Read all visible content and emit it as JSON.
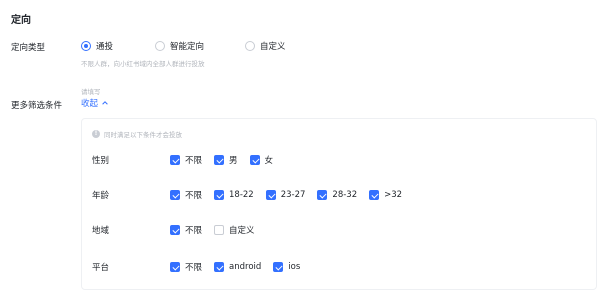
{
  "section": {
    "title": "定向"
  },
  "targeting_type": {
    "label": "定向类型",
    "options": [
      {
        "label": "通投",
        "checked": true
      },
      {
        "label": "智能定向",
        "checked": false
      },
      {
        "label": "自定义",
        "checked": false
      }
    ],
    "hint": "不限人群，向小红书域内全部人群进行投放"
  },
  "more_filters": {
    "label": "更多筛选条件",
    "hint": "请填写",
    "collapse_label": "收起"
  },
  "panel": {
    "notice": "同时满足以下条件才会投放",
    "rows": [
      {
        "label": "性别",
        "options": [
          {
            "label": "不限",
            "checked": true
          },
          {
            "label": "男",
            "checked": true
          },
          {
            "label": "女",
            "checked": true
          }
        ]
      },
      {
        "label": "年龄",
        "options": [
          {
            "label": "不限",
            "checked": true
          },
          {
            "label": "18-22",
            "checked": true
          },
          {
            "label": "23-27",
            "checked": true
          },
          {
            "label": "28-32",
            "checked": true
          },
          {
            "label": ">32",
            "checked": true
          }
        ]
      },
      {
        "label": "地域",
        "options": [
          {
            "label": "不限",
            "checked": true
          },
          {
            "label": "自定义",
            "checked": false
          }
        ]
      },
      {
        "label": "平台",
        "options": [
          {
            "label": "不限",
            "checked": true
          },
          {
            "label": "android",
            "checked": true
          },
          {
            "label": "ios",
            "checked": true
          }
        ]
      }
    ]
  },
  "colors": {
    "accent": "#3370ff",
    "muted": "#b0b4bb",
    "border": "#c9cdd4"
  },
  "icons": {
    "chevron": "chevron-up-icon",
    "info": "info-icon"
  }
}
